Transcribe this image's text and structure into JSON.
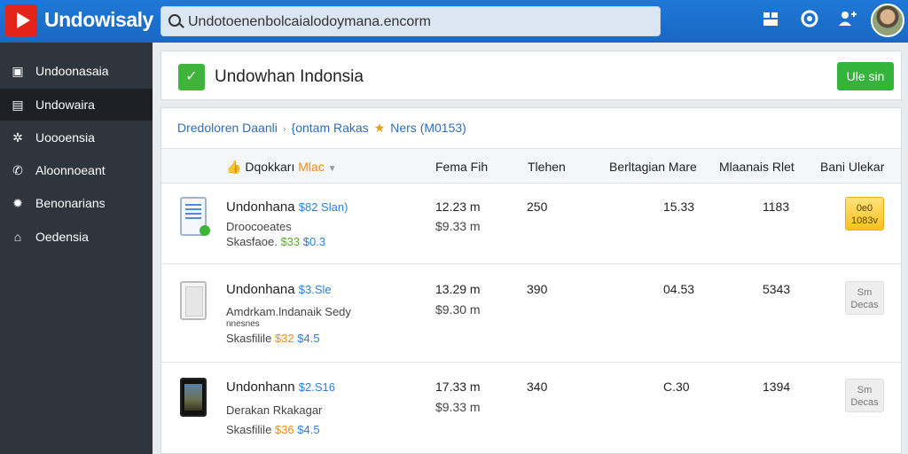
{
  "app": {
    "brand": "Undowisaly"
  },
  "search": {
    "value": "Undotoenenbolcaialodoymana.encorm"
  },
  "sidebar": {
    "items": [
      {
        "label": "Undoonasaia",
        "icon": "calendar-icon",
        "active": false
      },
      {
        "label": "Undowaira",
        "icon": "card-icon",
        "active": true
      },
      {
        "label": "Uoooensia",
        "icon": "settings-icon",
        "active": false
      },
      {
        "label": "Aloonnoeant",
        "icon": "phone-icon",
        "active": false
      },
      {
        "label": "Benonarians",
        "icon": "gear-icon",
        "active": false
      },
      {
        "label": "Oedensia",
        "icon": "home-icon",
        "active": false
      }
    ]
  },
  "page": {
    "title": "Undowhan Indonsia",
    "button_label": "Ule sin"
  },
  "breadcrumb": {
    "first": "Dredoloren Daanli",
    "second": "{ontam Rakas",
    "third": "Ners (M0153)"
  },
  "table": {
    "columns": {
      "product_prefix": "Dqokkarı",
      "product_highlight": "Mlac",
      "col1": "Fema Fih",
      "col2": "Tlehen",
      "col3": "Berltagian Mare",
      "col4": "Mlaanais Rlet",
      "col5": "Bani Ulekar"
    },
    "rows": [
      {
        "name": "Undonhana",
        "price": "$82 Slan)",
        "subtitle": "Droocoeates",
        "meta_label": "Skasfaoe.",
        "meta_green": "$33",
        "meta_blue": "$0.3",
        "c1a": "12.23 m",
        "c1b": "$9.33 m",
        "c2": "250",
        "c3": "15.33",
        "c4": "1183",
        "status_line1": "0e0",
        "status_line2": "1083v",
        "status_style": "yellow",
        "thumb": "document"
      },
      {
        "name": "Undonhana",
        "price": "$3.Sle",
        "subtitle": "Amdrkam.lndanaik Sedy",
        "subtitle2": "nnesnes",
        "meta_label": "Skasfilile",
        "meta_green": "$32",
        "meta_blue": "$4.5",
        "c1a": "13.29 m",
        "c1b": "$9.30 m",
        "c2": "390",
        "c3": "04.53",
        "c4": "5343",
        "status_line1": "Sm",
        "status_line2": "Decas",
        "status_style": "gray",
        "thumb": "tablet"
      },
      {
        "name": "Undonhann",
        "price": "$2.S16",
        "subtitle": "Derakan Rkakagar",
        "meta_label": "Skasfilile",
        "meta_green": "$36",
        "meta_blue": "$4.5",
        "c1a": "17.33 m",
        "c1b": "$9.33 m",
        "c2": "340",
        "c3": "C.30",
        "c4": "1394",
        "status_line1": "Sm",
        "status_line2": "Decas",
        "status_style": "gray",
        "thumb": "phone"
      }
    ]
  }
}
